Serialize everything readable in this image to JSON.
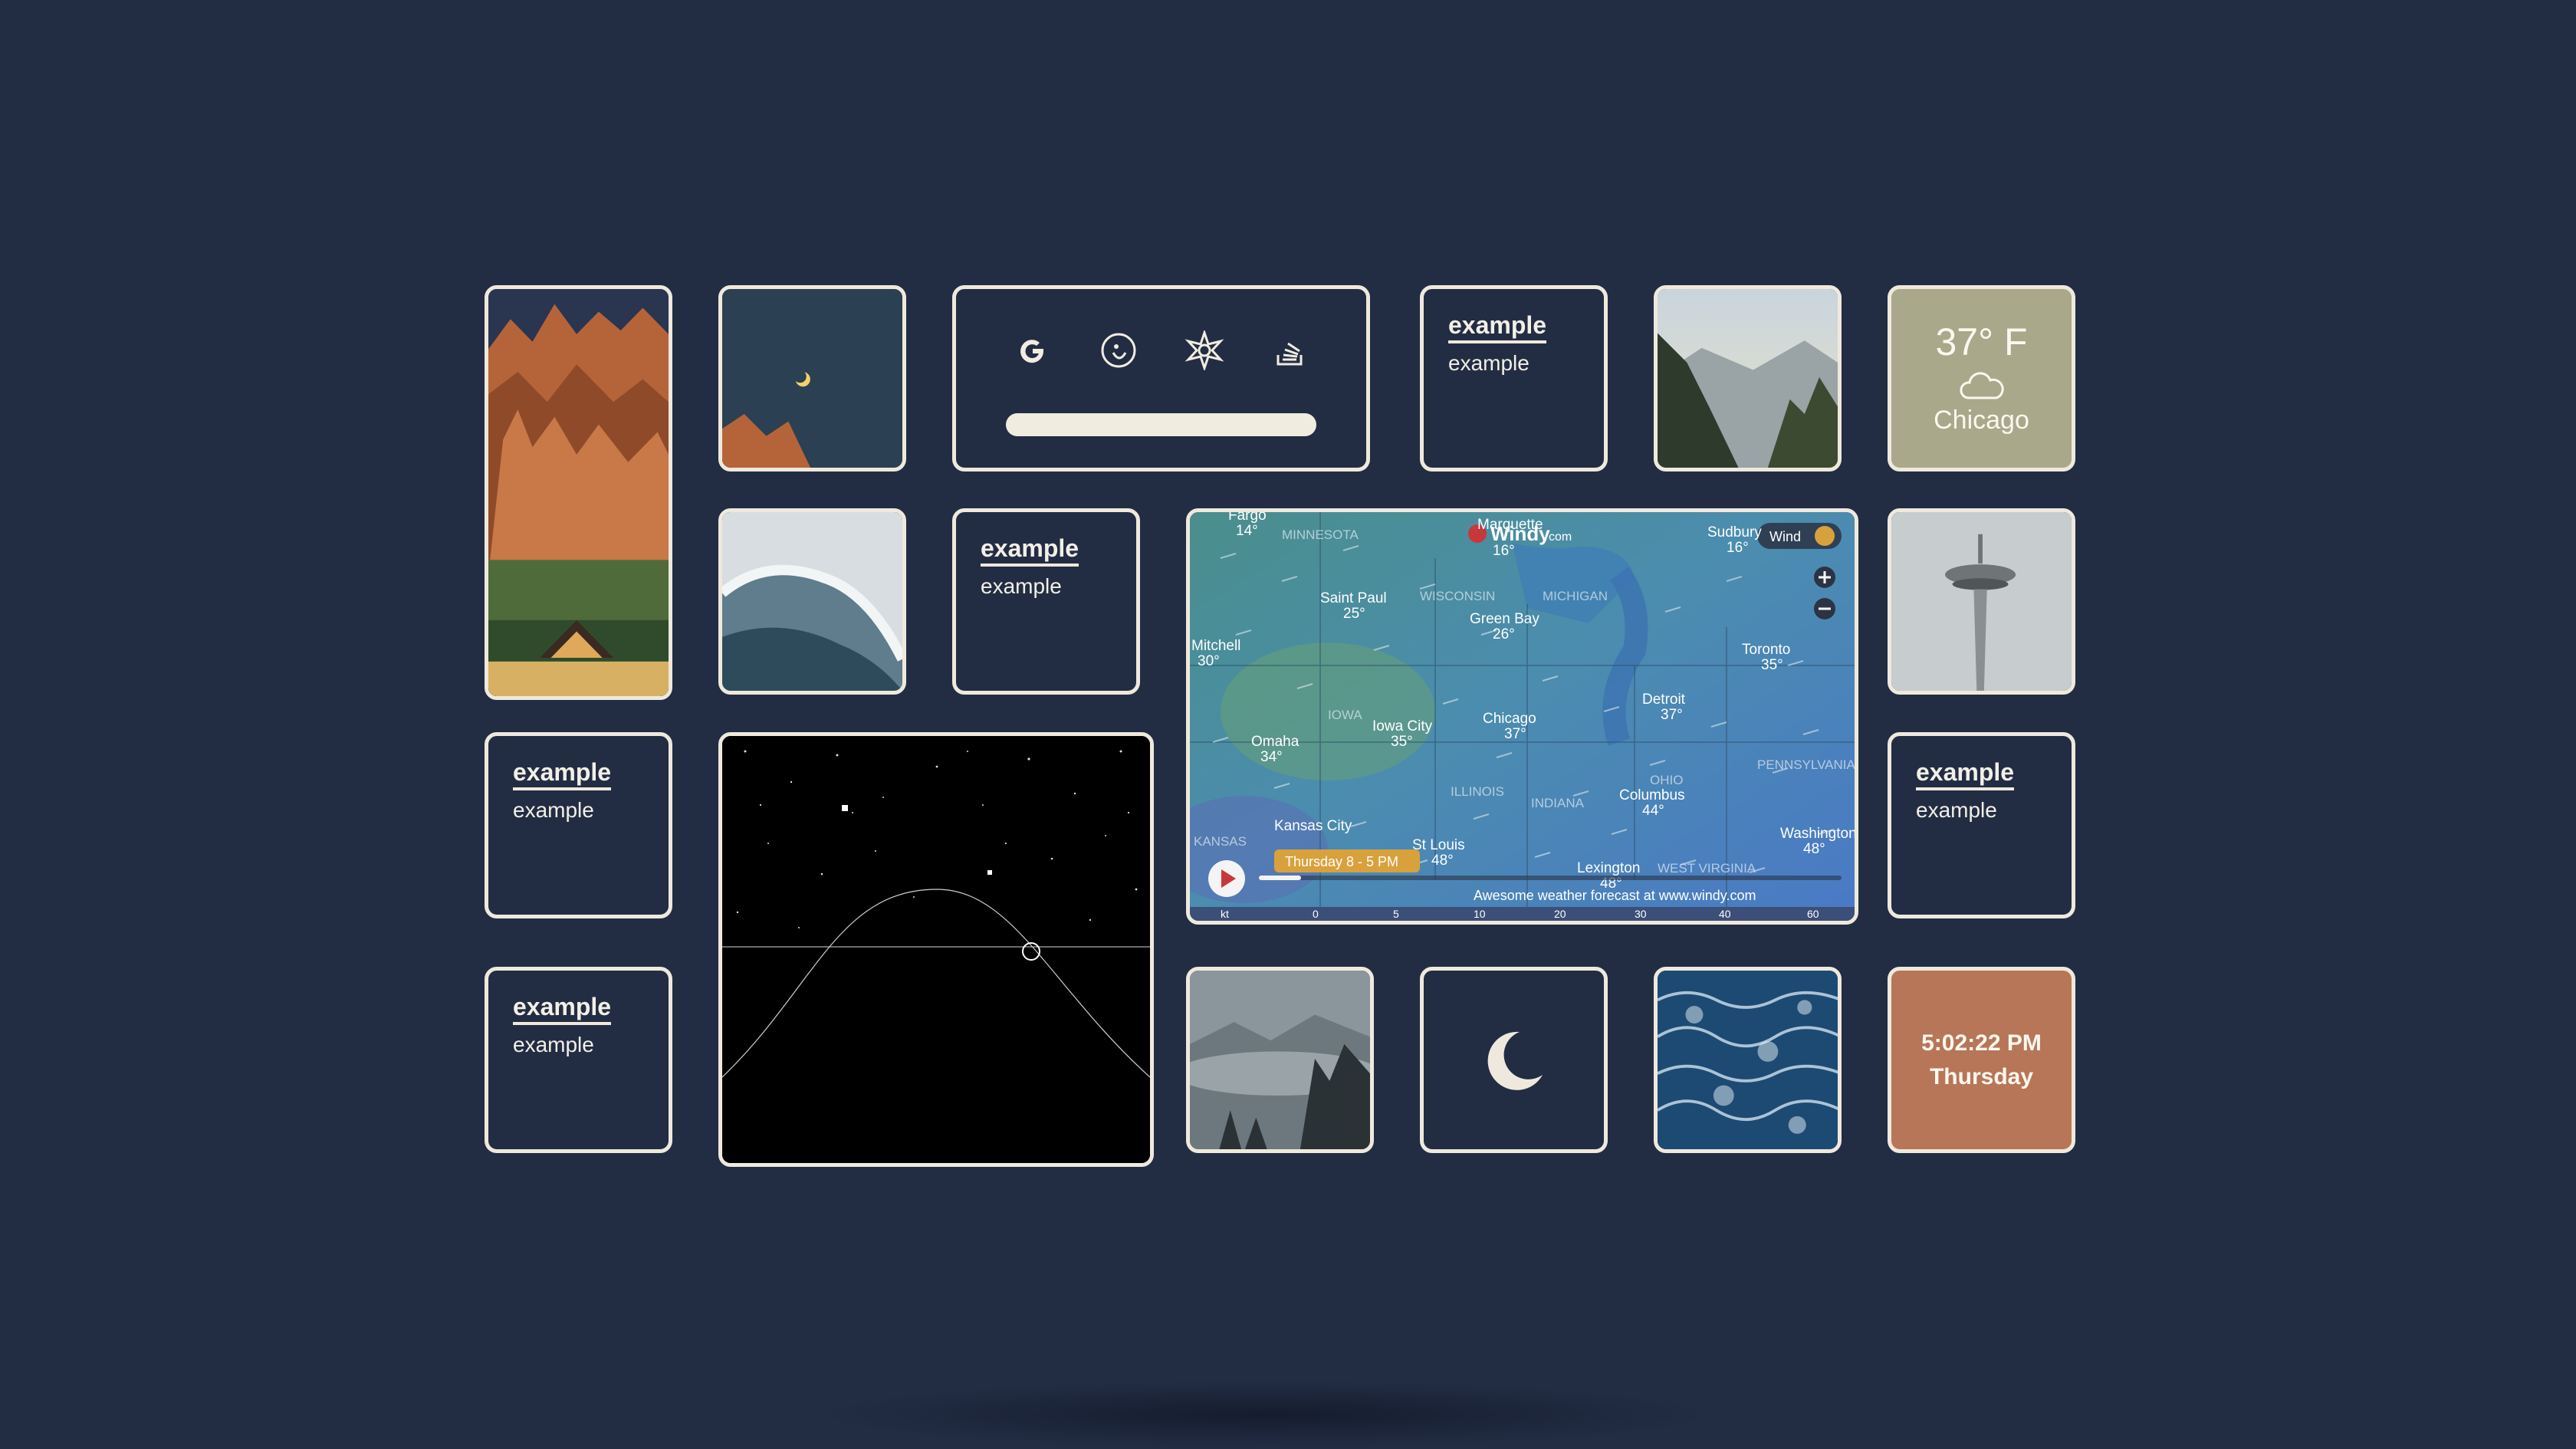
{
  "links": [
    {
      "title": "example",
      "subtitle": "example"
    },
    {
      "title": "example",
      "subtitle": "example"
    },
    {
      "title": "example",
      "subtitle": "example"
    },
    {
      "title": "example",
      "subtitle": "example"
    },
    {
      "title": "example",
      "subtitle": "example"
    },
    {
      "title": "example",
      "subtitle": "example"
    }
  ],
  "search": {
    "engines": [
      "google",
      "duckduckgo",
      "wolfram",
      "stackoverflow"
    ],
    "placeholder": ""
  },
  "weather": {
    "temperature": "37° F",
    "icon": "cloud-icon",
    "city": "Chicago"
  },
  "clock": {
    "time": "5:02:22 PM",
    "day": "Thursday"
  },
  "moon": {
    "icon": "crescent-moon-icon"
  },
  "windy": {
    "brand": "Windy",
    "brand_suffix": "com",
    "layer": "Wind",
    "time_label": "Thursday 8 - 5 PM",
    "attribution": "Awesome weather forecast at www.windy.com",
    "legend": [
      "kt",
      "0",
      "5",
      "10",
      "20",
      "30",
      "40",
      "60"
    ],
    "cities": [
      {
        "name": "Fargo",
        "temp": "14°"
      },
      {
        "name": "Marquette",
        "temp": "16°"
      },
      {
        "name": "Sudbury",
        "temp": "16°"
      },
      {
        "name": "Saint Paul",
        "temp": "25°"
      },
      {
        "name": "Green Bay",
        "temp": "26°"
      },
      {
        "name": "Mitchell",
        "temp": "30°"
      },
      {
        "name": "Toronto",
        "temp": "35°"
      },
      {
        "name": "Iowa City",
        "temp": "35°"
      },
      {
        "name": "Chicago",
        "temp": "37°"
      },
      {
        "name": "Detroit",
        "temp": "37°"
      },
      {
        "name": "Omaha",
        "temp": "34°"
      },
      {
        "name": "Columbus",
        "temp": "44°"
      },
      {
        "name": "Kansas City",
        "temp": ""
      },
      {
        "name": "St Louis",
        "temp": "48°"
      },
      {
        "name": "Lexington",
        "temp": "48°"
      },
      {
        "name": "Washington",
        "temp": "48°"
      }
    ],
    "regions": [
      "MINNESOTA",
      "WISCONSIN",
      "MICHIGAN",
      "IOWA",
      "ILLINOIS",
      "INDIANA",
      "OHIO",
      "PENNSYLVANIA",
      "WEST VIRGINIA",
      "KANSAS"
    ]
  },
  "colors": {
    "background": "#222d44",
    "tile_border": "#efe9dd",
    "weather_bg": "#a9a88a",
    "clock_bg": "#b77657",
    "windy_label": "#d9a13c"
  }
}
